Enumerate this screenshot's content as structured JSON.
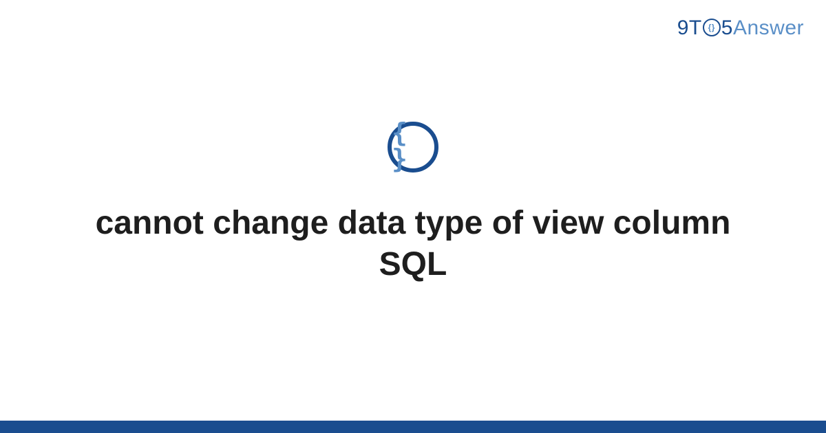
{
  "brand": {
    "part1": "9T",
    "circle_inner": "{}",
    "part2": "5",
    "part3": "Answer"
  },
  "icon": {
    "braces": "{ }"
  },
  "title": "cannot change data type of view column SQL",
  "colors": {
    "primary": "#1a4d8f",
    "secondary": "#5a8fc7",
    "text": "#1e1e1e",
    "background": "#ffffff"
  }
}
